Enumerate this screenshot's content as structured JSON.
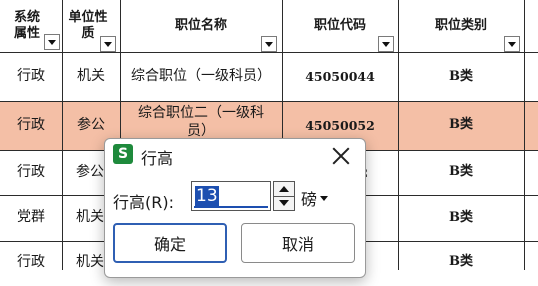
{
  "columns": [
    {
      "label": "系统属性"
    },
    {
      "label": "单位性质"
    },
    {
      "label": "职位名称"
    },
    {
      "label": "职位代码"
    },
    {
      "label": "职位类别"
    }
  ],
  "rows": [
    {
      "system": "行政",
      "unit": "机关",
      "position": "综合职位（一级科员）",
      "code": "45050044",
      "category": "B类"
    },
    {
      "system": "行政",
      "unit": "参公",
      "position": "综合职位二（一级科员）",
      "code": "45050052",
      "category": "B类"
    },
    {
      "system": "行政",
      "unit": "参公",
      "position": "",
      "code": "2",
      "category": "B类"
    },
    {
      "system": "党群",
      "unit": "机关",
      "position": "",
      "code": "",
      "category": "B类"
    },
    {
      "system": "行政",
      "unit": "机关",
      "position": "",
      "code": "",
      "category": "B类"
    }
  ],
  "highlight_color": "#f4bfa6",
  "dialog": {
    "app_icon": "S",
    "title": "行高",
    "field_label": "行高(R):",
    "value": "13",
    "unit": "磅",
    "ok_label": "确定",
    "cancel_label": "取消"
  }
}
